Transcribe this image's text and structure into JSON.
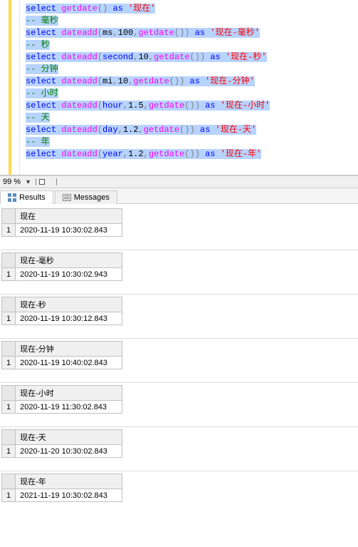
{
  "code": {
    "lines": [
      {
        "type": "code",
        "tokens": [
          {
            "cls": "kw",
            "t": "select"
          },
          {
            "cls": "",
            "t": " "
          },
          {
            "cls": "fn",
            "t": "getdate"
          },
          {
            "cls": "punc",
            "t": "()"
          },
          {
            "cls": "",
            "t": " "
          },
          {
            "cls": "kw",
            "t": "as"
          },
          {
            "cls": "",
            "t": " "
          },
          {
            "cls": "str",
            "t": "'现在'"
          }
        ],
        "sel": true
      },
      {
        "type": "cmt",
        "text": "-- 毫秒",
        "sel": true
      },
      {
        "type": "code",
        "tokens": [
          {
            "cls": "kw",
            "t": "select"
          },
          {
            "cls": "",
            "t": " "
          },
          {
            "cls": "fn",
            "t": "dateadd"
          },
          {
            "cls": "punc",
            "t": "("
          },
          {
            "cls": "",
            "t": "ms"
          },
          {
            "cls": "punc",
            "t": ","
          },
          {
            "cls": "num",
            "t": "100"
          },
          {
            "cls": "punc",
            "t": ","
          },
          {
            "cls": "fn",
            "t": "getdate"
          },
          {
            "cls": "punc",
            "t": "())"
          },
          {
            "cls": "",
            "t": " "
          },
          {
            "cls": "kw",
            "t": "as"
          },
          {
            "cls": "",
            "t": " "
          },
          {
            "cls": "str",
            "t": "'现在-毫秒'"
          }
        ],
        "sel": true
      },
      {
        "type": "cmt",
        "text": "-- 秒",
        "sel": true
      },
      {
        "type": "code",
        "tokens": [
          {
            "cls": "kw",
            "t": "select"
          },
          {
            "cls": "",
            "t": " "
          },
          {
            "cls": "fn",
            "t": "dateadd"
          },
          {
            "cls": "punc",
            "t": "("
          },
          {
            "cls": "kw",
            "t": "second"
          },
          {
            "cls": "punc",
            "t": ","
          },
          {
            "cls": "num",
            "t": "10"
          },
          {
            "cls": "punc",
            "t": ","
          },
          {
            "cls": "fn",
            "t": "getdate"
          },
          {
            "cls": "punc",
            "t": "())"
          },
          {
            "cls": "",
            "t": " "
          },
          {
            "cls": "kw",
            "t": "as"
          },
          {
            "cls": "",
            "t": " "
          },
          {
            "cls": "str",
            "t": "'现在-秒'"
          }
        ],
        "sel": true
      },
      {
        "type": "cmt",
        "text": "-- 分钟",
        "sel": true
      },
      {
        "type": "code",
        "tokens": [
          {
            "cls": "kw",
            "t": "select"
          },
          {
            "cls": "",
            "t": " "
          },
          {
            "cls": "fn",
            "t": "dateadd"
          },
          {
            "cls": "punc",
            "t": "("
          },
          {
            "cls": "",
            "t": "mi"
          },
          {
            "cls": "punc",
            "t": ","
          },
          {
            "cls": "num",
            "t": "10"
          },
          {
            "cls": "punc",
            "t": ","
          },
          {
            "cls": "fn",
            "t": "getdate"
          },
          {
            "cls": "punc",
            "t": "())"
          },
          {
            "cls": "",
            "t": " "
          },
          {
            "cls": "kw",
            "t": "as"
          },
          {
            "cls": "",
            "t": " "
          },
          {
            "cls": "str",
            "t": "'现在-分钟'"
          }
        ],
        "sel": true
      },
      {
        "type": "cmt",
        "text": "-- 小时",
        "sel": true
      },
      {
        "type": "code",
        "tokens": [
          {
            "cls": "kw",
            "t": "select"
          },
          {
            "cls": "",
            "t": " "
          },
          {
            "cls": "fn",
            "t": "dateadd"
          },
          {
            "cls": "punc",
            "t": "("
          },
          {
            "cls": "kw",
            "t": "hour"
          },
          {
            "cls": "punc",
            "t": ","
          },
          {
            "cls": "num",
            "t": "1.5"
          },
          {
            "cls": "punc",
            "t": ","
          },
          {
            "cls": "fn",
            "t": "getdate"
          },
          {
            "cls": "punc",
            "t": "())"
          },
          {
            "cls": "",
            "t": " "
          },
          {
            "cls": "kw",
            "t": "as"
          },
          {
            "cls": "",
            "t": " "
          },
          {
            "cls": "str",
            "t": "'现在-小时'"
          }
        ],
        "sel": true
      },
      {
        "type": "cmt",
        "text": "-- 天",
        "sel": true
      },
      {
        "type": "code",
        "tokens": [
          {
            "cls": "kw",
            "t": "select"
          },
          {
            "cls": "",
            "t": " "
          },
          {
            "cls": "fn",
            "t": "dateadd"
          },
          {
            "cls": "punc",
            "t": "("
          },
          {
            "cls": "kw",
            "t": "day"
          },
          {
            "cls": "punc",
            "t": ","
          },
          {
            "cls": "num",
            "t": "1.2"
          },
          {
            "cls": "punc",
            "t": ","
          },
          {
            "cls": "fn",
            "t": "getdate"
          },
          {
            "cls": "punc",
            "t": "())"
          },
          {
            "cls": "",
            "t": " "
          },
          {
            "cls": "kw",
            "t": "as"
          },
          {
            "cls": "",
            "t": " "
          },
          {
            "cls": "str",
            "t": "'现在-天'"
          }
        ],
        "sel": true
      },
      {
        "type": "cmt",
        "text": "-- 年",
        "sel": true
      },
      {
        "type": "code",
        "tokens": [
          {
            "cls": "kw",
            "t": "select"
          },
          {
            "cls": "",
            "t": " "
          },
          {
            "cls": "fn",
            "t": "dateadd"
          },
          {
            "cls": "punc",
            "t": "("
          },
          {
            "cls": "kw",
            "t": "year"
          },
          {
            "cls": "punc",
            "t": ","
          },
          {
            "cls": "num",
            "t": "1.2"
          },
          {
            "cls": "punc",
            "t": ","
          },
          {
            "cls": "fn",
            "t": "getdate"
          },
          {
            "cls": "punc",
            "t": "())"
          },
          {
            "cls": "",
            "t": " "
          },
          {
            "cls": "kw",
            "t": "as"
          },
          {
            "cls": "",
            "t": " "
          },
          {
            "cls": "str",
            "t": "'现在-年'"
          }
        ],
        "sel": true
      }
    ]
  },
  "zoom": {
    "label": "99 %"
  },
  "tabs": {
    "results": "Results",
    "messages": "Messages"
  },
  "results": [
    {
      "header": "现在",
      "rownum": "1",
      "value": "2020-11-19 10:30:02.843"
    },
    {
      "header": "现在-毫秒",
      "rownum": "1",
      "value": "2020-11-19 10:30:02.943"
    },
    {
      "header": "现在-秒",
      "rownum": "1",
      "value": "2020-11-19 10:30:12.843"
    },
    {
      "header": "现在-分钟",
      "rownum": "1",
      "value": "2020-11-19 10:40:02.843"
    },
    {
      "header": "现在-小时",
      "rownum": "1",
      "value": "2020-11-19 11:30:02.843"
    },
    {
      "header": "现在-天",
      "rownum": "1",
      "value": "2020-11-20 10:30:02.843"
    },
    {
      "header": "现在-年",
      "rownum": "1",
      "value": "2021-11-19 10:30:02.843"
    }
  ]
}
